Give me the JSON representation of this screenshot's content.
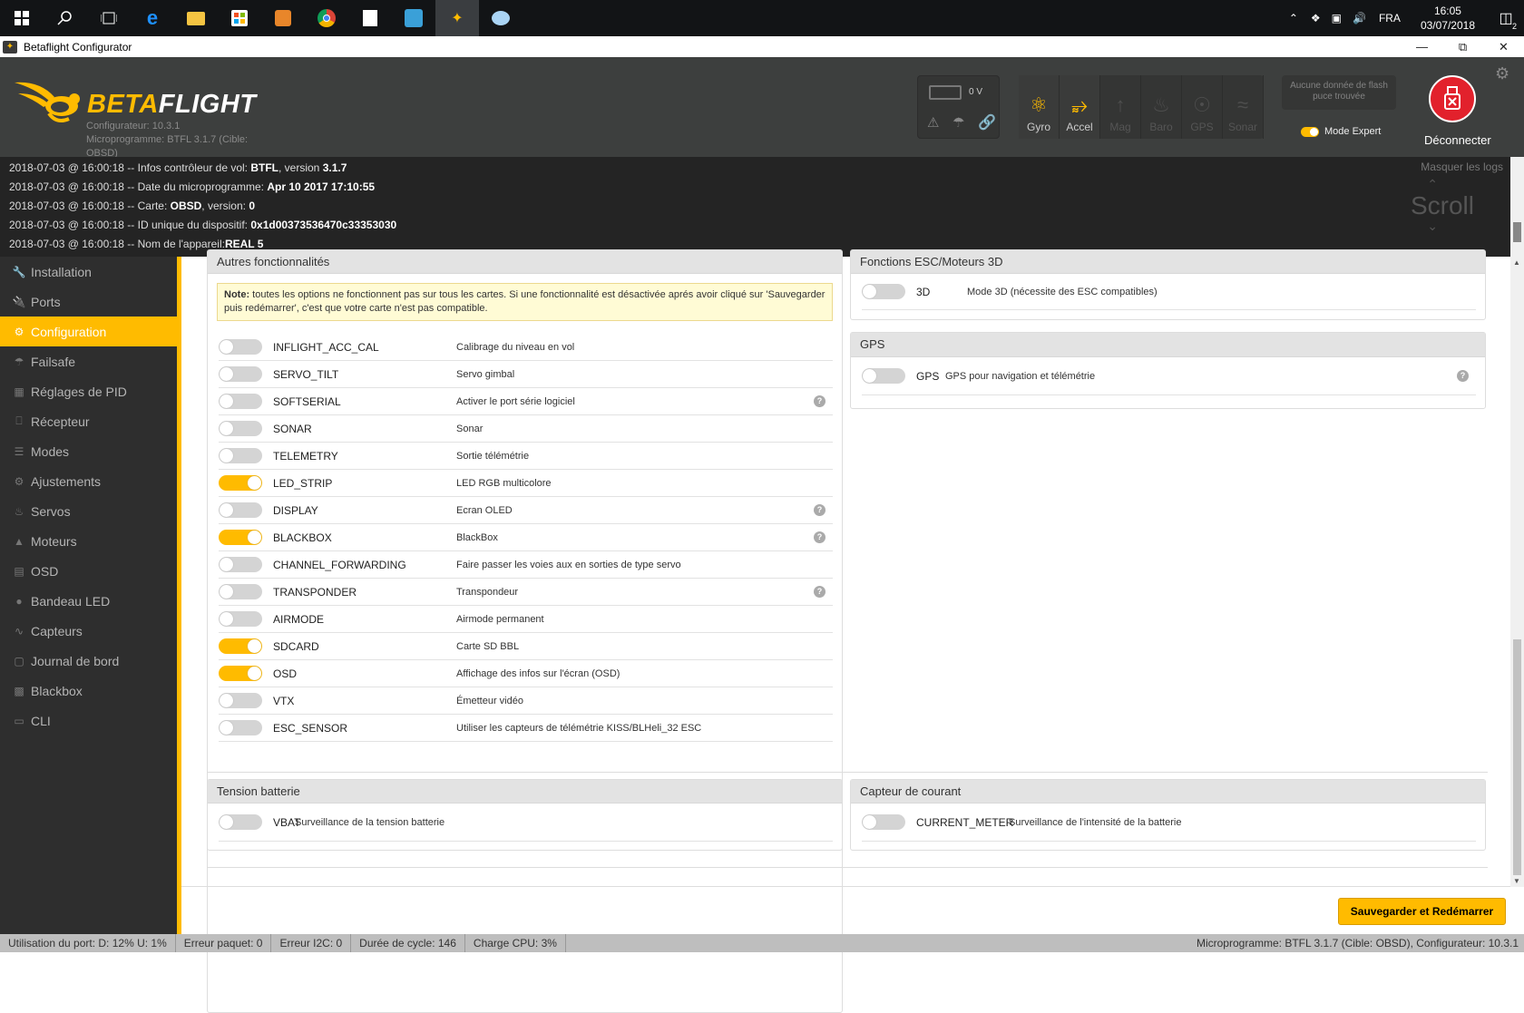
{
  "taskbar": {
    "language": "FRA",
    "time": "16:05",
    "date": "03/07/2018",
    "notification_count": "2"
  },
  "window": {
    "title": "Betaflight Configurator"
  },
  "header": {
    "logo_beta": "BETA",
    "logo_flight": "FLIGHT",
    "configurator_version": "Configurateur: 10.3.1",
    "firmware_line1": "Microprogramme: BTFL 3.1.7 (Cible:",
    "firmware_line2": "OBSD)",
    "battery_voltage": "0 V",
    "sensors": [
      {
        "label": "Gyro",
        "icon": "gyro-icon",
        "active": true
      },
      {
        "label": "Accel",
        "icon": "accel-icon",
        "active": true
      },
      {
        "label": "Mag",
        "icon": "mag-icon",
        "active": false
      },
      {
        "label": "Baro",
        "icon": "baro-icon",
        "active": false
      },
      {
        "label": "GPS",
        "icon": "gps-icon",
        "active": false
      },
      {
        "label": "Sonar",
        "icon": "sonar-icon",
        "active": false
      }
    ],
    "flash_status": "Aucune donnée de flash puce trouvée",
    "expert_mode_label": "Mode Expert",
    "expert_mode_on": true,
    "disconnect_label": "Déconnecter"
  },
  "logs": {
    "hide_label": "Masquer les logs",
    "scroll_label": "Scroll",
    "lines": [
      {
        "prefix": "2018-07-03 @ 16:00:18 -- Infos contrôleur de vol: ",
        "b1": "BTFL",
        "mid": ", version ",
        "b2": "3.1.7"
      },
      {
        "prefix": "2018-07-03 @ 16:00:18 -- Date du microprogramme: ",
        "b1": "Apr 10 2017 17:10:55",
        "mid": "",
        "b2": ""
      },
      {
        "prefix": "2018-07-03 @ 16:00:18 -- Carte: ",
        "b1": "OBSD",
        "mid": ", version: ",
        "b2": "0"
      },
      {
        "prefix": "2018-07-03 @ 16:00:18 -- ID unique du dispositif: ",
        "b1": "0x1d00373536470c33353030",
        "mid": "",
        "b2": ""
      },
      {
        "prefix": "2018-07-03 @ 16:00:18 -- Nom de l'appareil:",
        "b1": "REAL 5",
        "mid": "",
        "b2": ""
      }
    ]
  },
  "sidebar": {
    "items": [
      {
        "label": "Installation",
        "icon": "wrench-icon",
        "active": false
      },
      {
        "label": "Ports",
        "icon": "plug-icon",
        "active": false
      },
      {
        "label": "Configuration",
        "icon": "gear-icon",
        "active": true
      },
      {
        "label": "Failsafe",
        "icon": "parachute-icon",
        "active": false
      },
      {
        "label": "Réglages de PID",
        "icon": "pid-icon",
        "active": false
      },
      {
        "label": "Récepteur",
        "icon": "receiver-icon",
        "active": false
      },
      {
        "label": "Modes",
        "icon": "modes-icon",
        "active": false
      },
      {
        "label": "Ajustements",
        "icon": "sliders-icon",
        "active": false
      },
      {
        "label": "Servos",
        "icon": "servo-icon",
        "active": false
      },
      {
        "label": "Moteurs",
        "icon": "motor-icon",
        "active": false
      },
      {
        "label": "OSD",
        "icon": "osd-icon",
        "active": false
      },
      {
        "label": "Bandeau LED",
        "icon": "led-icon",
        "active": false
      },
      {
        "label": "Capteurs",
        "icon": "sensors-icon",
        "active": false
      },
      {
        "label": "Journal de bord",
        "icon": "log-icon",
        "active": false
      },
      {
        "label": "Blackbox",
        "icon": "blackbox-icon",
        "active": false
      },
      {
        "label": "CLI",
        "icon": "cli-icon",
        "active": false
      }
    ]
  },
  "features_panel": {
    "title": "Autres fonctionnalités",
    "note_bold": "Note:",
    "note_text": " toutes les options ne fonctionnent pas sur tous les cartes. Si une fonctionnalité est désactivée aprés avoir cliqué sur 'Sauvegarder puis redémarrer', c'est que votre carte n'est pas compatible.",
    "features": [
      {
        "name": "INFLIGHT_ACC_CAL",
        "desc": "Calibrage du niveau en vol",
        "on": false,
        "help": false
      },
      {
        "name": "SERVO_TILT",
        "desc": "Servo gimbal",
        "on": false,
        "help": false
      },
      {
        "name": "SOFTSERIAL",
        "desc": "Activer le port série logiciel",
        "on": false,
        "help": true
      },
      {
        "name": "SONAR",
        "desc": "Sonar",
        "on": false,
        "help": false
      },
      {
        "name": "TELEMETRY",
        "desc": "Sortie télémétrie",
        "on": false,
        "help": false
      },
      {
        "name": "LED_STRIP",
        "desc": "LED RGB multicolore",
        "on": true,
        "help": false
      },
      {
        "name": "DISPLAY",
        "desc": "Ecran OLED",
        "on": false,
        "help": true
      },
      {
        "name": "BLACKBOX",
        "desc": "BlackBox",
        "on": true,
        "help": true
      },
      {
        "name": "CHANNEL_FORWARDING",
        "desc": "Faire passer les voies aux en sorties de type servo",
        "on": false,
        "help": false
      },
      {
        "name": "TRANSPONDER",
        "desc": "Transpondeur",
        "on": false,
        "help": true
      },
      {
        "name": "AIRMODE",
        "desc": "Airmode permanent",
        "on": false,
        "help": false
      },
      {
        "name": "SDCARD",
        "desc": "Carte SD BBL",
        "on": true,
        "help": false
      },
      {
        "name": "OSD",
        "desc": "Affichage des infos sur l'écran (OSD)",
        "on": true,
        "help": false
      },
      {
        "name": "VTX",
        "desc": "Émetteur vidéo",
        "on": false,
        "help": false
      },
      {
        "name": "ESC_SENSOR",
        "desc": "Utiliser les capteurs de télémétrie KISS/BLHeli_32 ESC",
        "on": false,
        "help": false
      }
    ]
  },
  "esc_panel": {
    "title": "Fonctions ESC/Moteurs 3D",
    "name": "3D",
    "desc": "Mode 3D (nécessite des ESC compatibles)",
    "on": false
  },
  "gps_panel": {
    "title": "GPS",
    "name": "GPS",
    "desc": "GPS pour navigation et télémétrie",
    "on": false
  },
  "battery_panel": {
    "title": "Tension batterie",
    "name": "VBAT",
    "desc": "Surveillance de la tension batterie",
    "on": false
  },
  "current_panel": {
    "title": "Capteur de courant",
    "name": "CURRENT_METER",
    "desc": "Surveillance de l'intensité de la batterie",
    "on": false
  },
  "save_button": "Sauvegarder et Redémarrer",
  "statusbar": {
    "port_usage": "Utilisation du port: D: 12% U: 1%",
    "packet_error": "Erreur paquet: 0",
    "i2c_error": "Erreur I2C: 0",
    "cycle_time": "Durée de cycle: 146",
    "cpu_load": "Charge CPU: 3%",
    "firmware": "Microprogramme: BTFL 3.1.7 (Cible: OBSD), Configurateur: 10.3.1"
  }
}
